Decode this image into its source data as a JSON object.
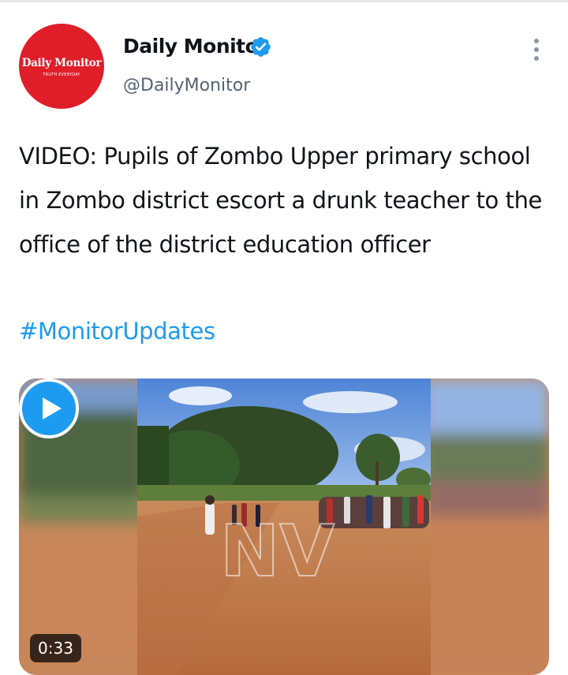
{
  "account": {
    "display_name": "Daily Monitor",
    "handle": "@DailyMonitor",
    "verified": true,
    "avatar_logo_text": "Daily Monitor",
    "avatar_tagline": "TRUTH EVERYDAY"
  },
  "tweet": {
    "text": "VIDEO: Pupils of Zombo Upper primary school in Zombo district escort a drunk teacher to the office of the district education officer",
    "hashtag": "#MonitorUpdates"
  },
  "media": {
    "type": "video",
    "duration": "0:33",
    "watermark": "NV"
  },
  "icons": {
    "verified": "verified-badge-icon",
    "more": "more-options-icon",
    "play": "play-icon"
  },
  "colors": {
    "verified_blue": "#1d9bf0",
    "hashtag_blue": "#1d9bf0",
    "avatar_red": "#e01e2a",
    "handle_gray": "#536471"
  }
}
